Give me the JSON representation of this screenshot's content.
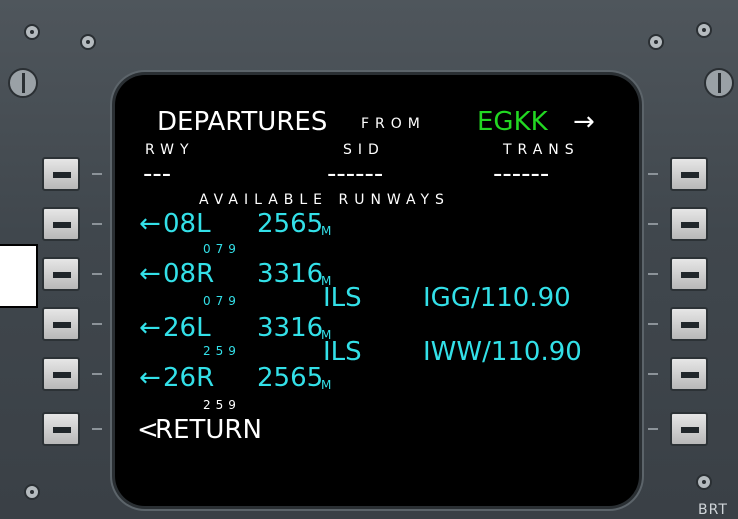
{
  "header": {
    "title": "DEPARTURES",
    "from_label": "FROM",
    "airport": "EGKK",
    "arrow": "→"
  },
  "columns": {
    "rwy": "RWY",
    "sid": "SID",
    "trans": "TRANS",
    "rwy_dashes": "---",
    "sid_dashes": "------",
    "trans_dashes": "------"
  },
  "available_label": "AVAILABLE RUNWAYS",
  "runways": [
    {
      "arrow": "←",
      "id": "08L",
      "length": "2565",
      "unit": "M",
      "heading": "079",
      "ils": "",
      "freq": ""
    },
    {
      "arrow": "←",
      "id": "08R",
      "length": "3316",
      "unit": "M",
      "heading": "079",
      "ils": "ILS",
      "freq": "IGG/110.90"
    },
    {
      "arrow": "←",
      "id": "26L",
      "length": "3316",
      "unit": "M",
      "heading": "259",
      "ils": "ILS",
      "freq": "IWW/110.90"
    },
    {
      "arrow": "←",
      "id": "26R",
      "length": "2565",
      "unit": "M",
      "heading": "259",
      "ils": "",
      "freq": ""
    }
  ],
  "return_label": "RETURN",
  "return_arrow": "<",
  "brt_label": "BRT",
  "colors": {
    "screen": "#000000",
    "white_text": "#ffffff",
    "cyan_text": "#33e0e8",
    "green_text": "#22d822",
    "bezel": "#454c52"
  }
}
